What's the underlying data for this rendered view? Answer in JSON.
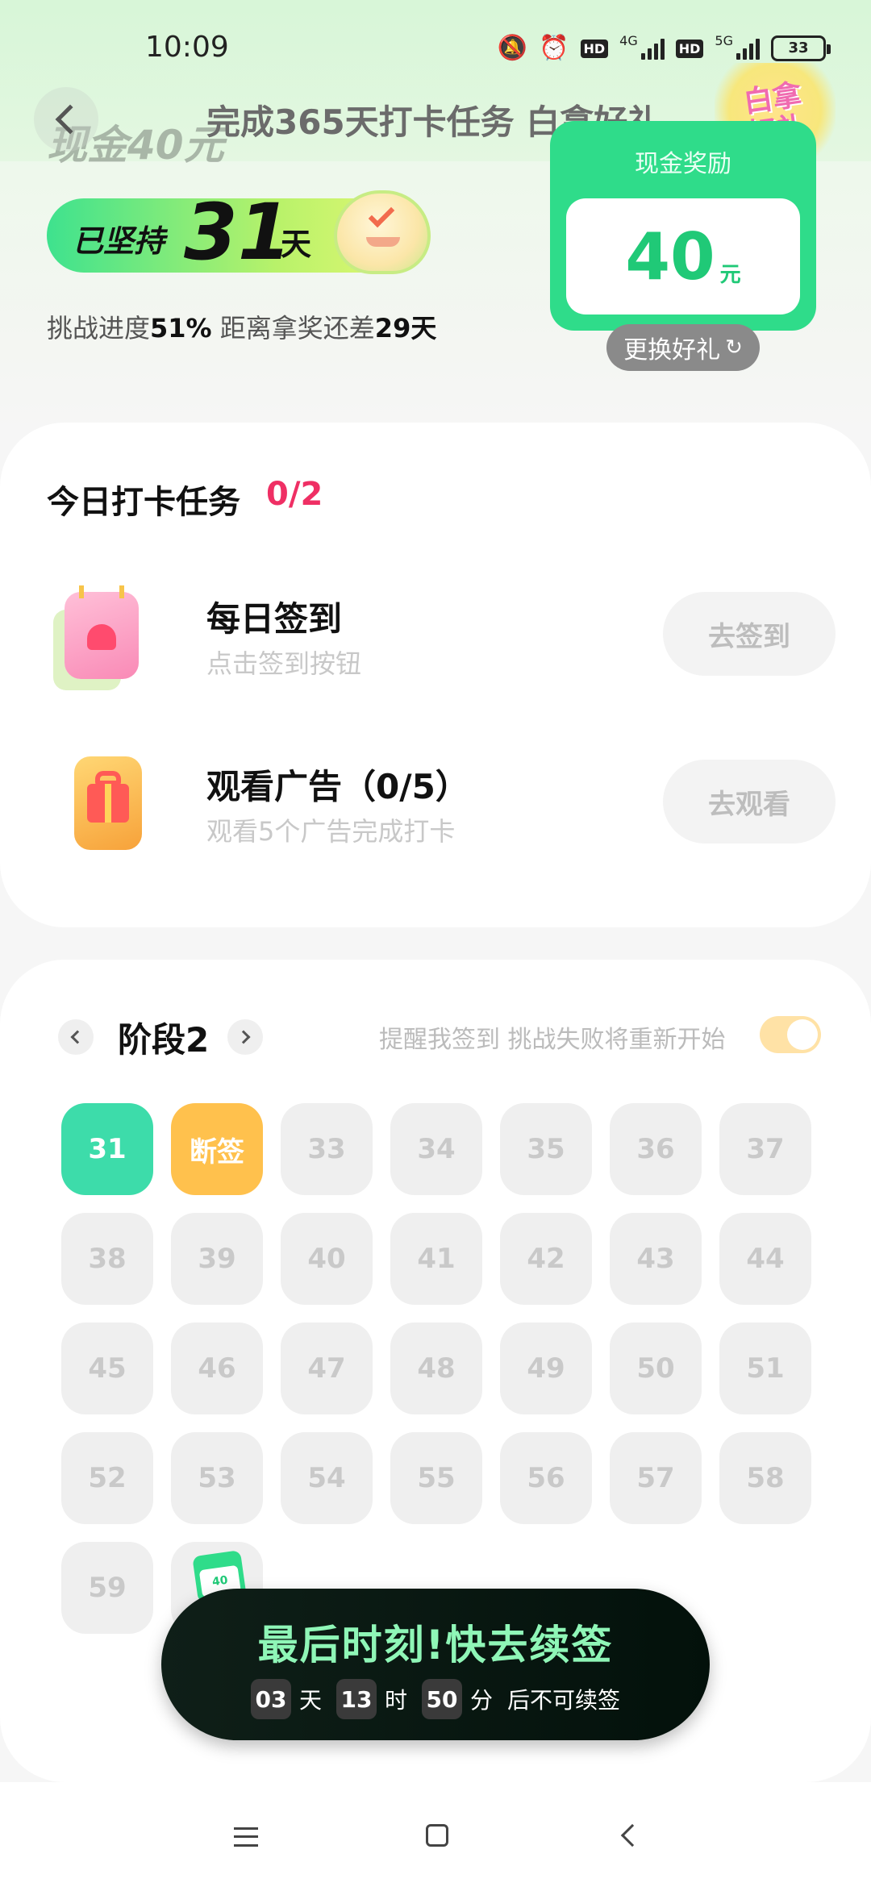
{
  "status_bar": {
    "time": "10:09",
    "hd1": "HD",
    "net1": "4G",
    "hd2": "HD",
    "net2": "5G",
    "battery": "33",
    "icons": [
      "mute-bell-icon",
      "alarm-icon",
      "signal-icon",
      "battery-icon"
    ]
  },
  "header": {
    "faded_cash": "现金40元",
    "title": "完成365天打卡任务 白拿好礼",
    "gift_badge": "白拿好礼"
  },
  "streak": {
    "prefix": "已坚持",
    "days": "31",
    "suffix": "天"
  },
  "progress": {
    "label": "挑战进度",
    "percent": "51%",
    "middle": " 距离拿奖还差",
    "remaining_days": "29天"
  },
  "reward_card": {
    "title": "现金奖励",
    "amount": "40",
    "unit": "元",
    "swap_label": "更换好礼"
  },
  "tasks": {
    "heading": "今日打卡任务",
    "count": "0/2",
    "items": [
      {
        "name": "每日签到",
        "desc": "点击签到按钮",
        "button": "去签到",
        "icon": "calendar-heart-icon"
      },
      {
        "name": "观看广告（0/5）",
        "desc": "观看5个广告完成打卡",
        "button": "去观看",
        "icon": "gift-phone-icon"
      }
    ]
  },
  "stage": {
    "title": "阶段2",
    "remind_text": "提醒我签到 挑战失败将重新开始",
    "toggle_on": true,
    "days": [
      {
        "label": "31",
        "state": "done"
      },
      {
        "label": "断签",
        "state": "broken"
      },
      {
        "label": "33",
        "state": "pending"
      },
      {
        "label": "34",
        "state": "pending"
      },
      {
        "label": "35",
        "state": "pending"
      },
      {
        "label": "36",
        "state": "pending"
      },
      {
        "label": "37",
        "state": "pending"
      },
      {
        "label": "38",
        "state": "pending"
      },
      {
        "label": "39",
        "state": "pending"
      },
      {
        "label": "40",
        "state": "pending"
      },
      {
        "label": "41",
        "state": "pending"
      },
      {
        "label": "42",
        "state": "pending"
      },
      {
        "label": "43",
        "state": "pending"
      },
      {
        "label": "44",
        "state": "pending"
      },
      {
        "label": "45",
        "state": "pending"
      },
      {
        "label": "46",
        "state": "pending"
      },
      {
        "label": "47",
        "state": "pending"
      },
      {
        "label": "48",
        "state": "pending"
      },
      {
        "label": "49",
        "state": "pending"
      },
      {
        "label": "50",
        "state": "pending"
      },
      {
        "label": "51",
        "state": "pending"
      },
      {
        "label": "52",
        "state": "pending"
      },
      {
        "label": "53",
        "state": "pending"
      },
      {
        "label": "54",
        "state": "pending"
      },
      {
        "label": "55",
        "state": "pending"
      },
      {
        "label": "56",
        "state": "pending"
      },
      {
        "label": "57",
        "state": "pending"
      },
      {
        "label": "58",
        "state": "pending"
      },
      {
        "label": "59",
        "state": "pending"
      },
      {
        "label": "",
        "state": "reward"
      }
    ],
    "reward_mini": "40"
  },
  "countdown": {
    "title": "最后时刻!快去续签",
    "days": "03",
    "days_unit": "天",
    "hours": "13",
    "hours_unit": "时",
    "minutes": "50",
    "minutes_unit": "分",
    "tail": "后不可续签"
  },
  "colors": {
    "accent_green": "#2fdc8a",
    "done_green": "#3ddcaa",
    "broken_orange": "#ffc14d",
    "count_red": "#ef2f64"
  }
}
